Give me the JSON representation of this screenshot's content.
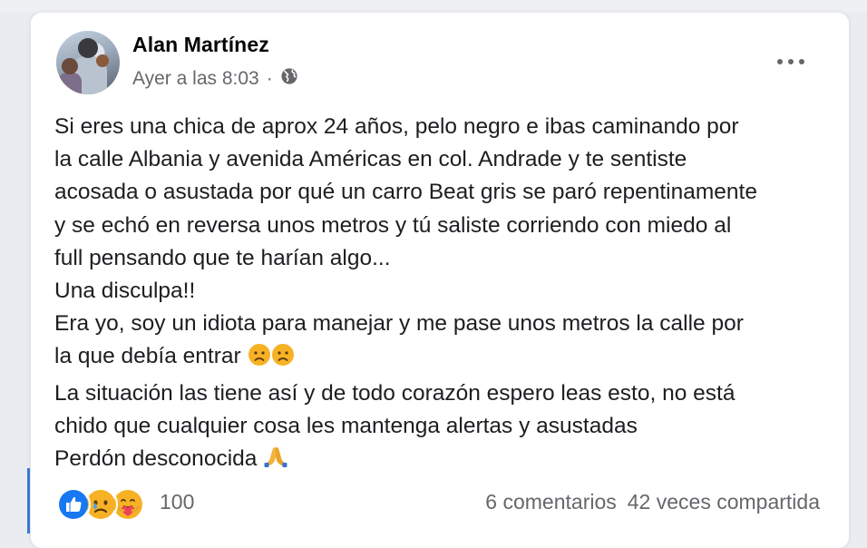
{
  "post": {
    "author": "Alan Martínez",
    "timestamp": "Ayer a las 8:03",
    "separator": "·",
    "privacy_icon": "globe-icon",
    "options_icon": "more-options-icon",
    "lines": [
      "Si eres una chica de aprox 24 años, pelo negro e ibas caminando por",
      "la calle Albania y avenida Américas en col. Andrade y te sentiste",
      "acosada o asustada por qué un carro Beat gris se paró repentinamente",
      "y se echó en reversa unos metros y tú saliste corriendo con miedo al",
      "full pensando que te harían algo...",
      "Una disculpa!!",
      "Era yo, soy un idiota para manejar y me pase unos metros la calle por",
      "la que debía entrar",
      "La situación las tiene así y de todo corazón espero leas esto, no está",
      "chido que cualquier cosa les mantenga alertas y asustadas",
      "Perdón desconocida"
    ],
    "emojis": {
      "line_8": [
        "worried-face-icon",
        "worried-face-icon"
      ],
      "line_11": [
        "folded-hands-icon"
      ]
    }
  },
  "footer": {
    "reactions": [
      "like-icon",
      "sad-icon",
      "care-icon"
    ],
    "reaction_count": "100",
    "comments": "6 comentarios",
    "shares": "42 veces compartida"
  },
  "colors": {
    "like_blue": "#1877f2",
    "sad_yellow": "#f7b125",
    "text": "#1c1e21",
    "secondary": "#65676b"
  }
}
